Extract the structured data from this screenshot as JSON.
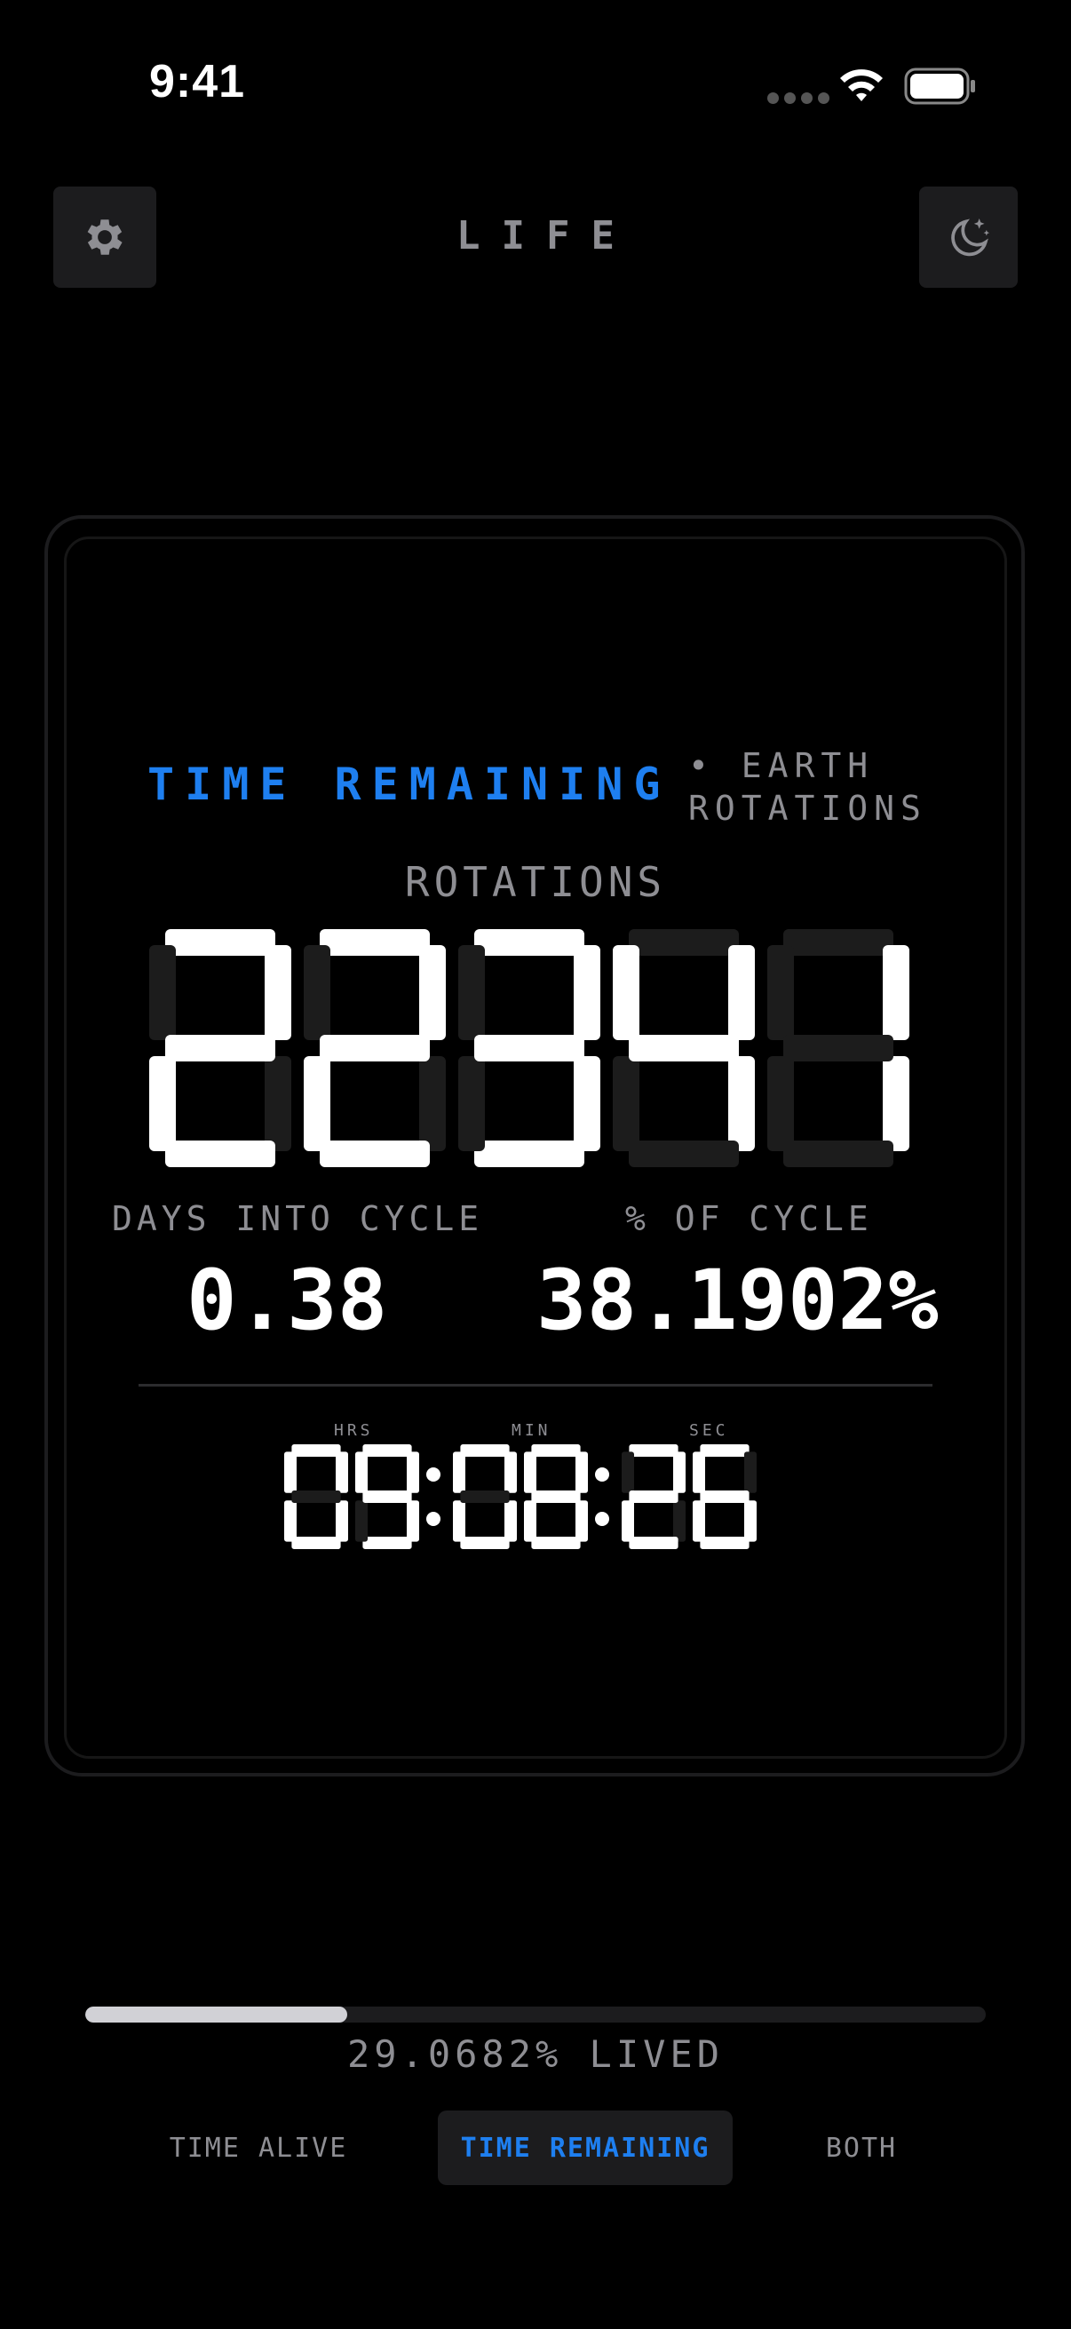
{
  "status_bar": {
    "time": "9:41"
  },
  "header": {
    "title": "LIFE",
    "settings_icon": "gear-icon",
    "theme_icon": "moon-stars-icon"
  },
  "card": {
    "mode_label": "TIME REMAINING",
    "sub_label": "• EARTH\nROTATIONS",
    "unit_label": "ROTATIONS",
    "rotations": "22341",
    "days_label": "DAYS INTO CYCLE",
    "days_value": "0.38",
    "pct_label": "% OF CYCLE",
    "pct_value": "38.1902%",
    "clock": {
      "hrs_label": "HRS",
      "min_label": "MIN",
      "sec_label": "SEC",
      "hrs": "09",
      "min": "08",
      "sec": "26"
    }
  },
  "progress": {
    "fraction": 0.2907,
    "text": "29.0682% LIVED"
  },
  "tabs": [
    {
      "label": "TIME ALIVE",
      "selected": false
    },
    {
      "label": "TIME REMAINING",
      "selected": true
    },
    {
      "label": "BOTH",
      "selected": false
    }
  ],
  "colors": {
    "accent": "#1e7ff0",
    "background": "#000000",
    "segment_off": "#1c1c1c"
  }
}
